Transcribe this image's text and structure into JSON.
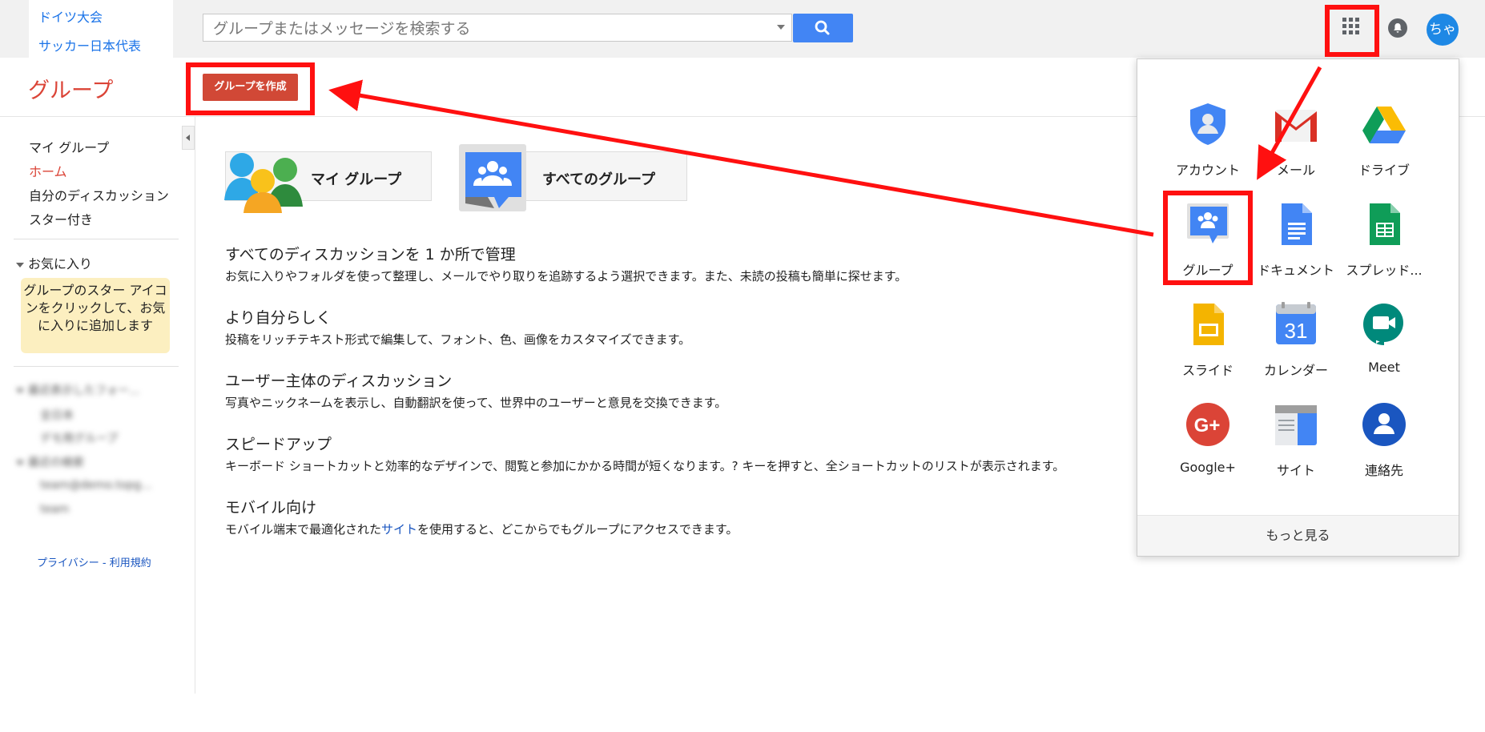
{
  "topbar": {
    "brand_links": [
      "ドイツ大会",
      "サッカー日本代表"
    ],
    "search_placeholder": "グループまたはメッセージを検索する",
    "avatar_text": "ちゃ"
  },
  "header": {
    "title": "グループ",
    "create_button": "グループを作成"
  },
  "sidebar": {
    "nav": [
      "マイ グループ",
      "ホーム",
      "自分のディスカッション",
      "スター付き"
    ],
    "active_index": 1,
    "favorites_header": "お気に入り",
    "favorites_tip": "グループのスター アイコンをクリックして、お気に入りに追加します",
    "recent_groups_header": "最近表示したフォー...",
    "recent_groups": [
      "全日本",
      "デモ用グループ"
    ],
    "recent_search_header": "最近の検索",
    "recent_searches": [
      "team@demo.topg...",
      "team"
    ],
    "footer": "プライバシー - 利用規約"
  },
  "main": {
    "cards": [
      "マイ グループ",
      "すべてのグループ"
    ],
    "sections": [
      {
        "title": "すべてのディスカッションを 1 か所で管理",
        "body": "お気に入りやフォルダを使って整理し、メールでやり取りを追跡するよう選択できます。また、未読の投稿も簡単に探せます。"
      },
      {
        "title": "より自分らしく",
        "body": "投稿をリッチテキスト形式で編集して、フォント、色、画像をカスタマイズできます。"
      },
      {
        "title": "ユーザー主体のディスカッション",
        "body": "写真やニックネームを表示し、自動翻訳を使って、世界中のユーザーと意見を交換できます。"
      },
      {
        "title": "スピードアップ",
        "body": "キーボード ショートカットと効率的なデザインで、閲覧と参加にかかる時間が短くなります。? キーを押すと、全ショートカットのリストが表示されます。"
      }
    ],
    "mobile": {
      "title": "モバイル向け",
      "body_before": "モバイル端末で最適化された",
      "link": "サイト",
      "body_after": "を使用すると、どこからでもグループにアクセスできます。"
    }
  },
  "apps_panel": {
    "apps": [
      {
        "label": "アカウント",
        "icon": "account-icon"
      },
      {
        "label": "メール",
        "icon": "gmail-icon"
      },
      {
        "label": "ドライブ",
        "icon": "drive-icon"
      },
      {
        "label": "グループ",
        "icon": "groups-icon"
      },
      {
        "label": "ドキュメント",
        "icon": "docs-icon"
      },
      {
        "label": "スプレッド...",
        "icon": "sheets-icon"
      },
      {
        "label": "スライド",
        "icon": "slides-icon"
      },
      {
        "label": "カレンダー",
        "icon": "calendar-icon"
      },
      {
        "label": "Meet",
        "icon": "meet-icon"
      },
      {
        "label": "Google+",
        "icon": "google-plus-icon"
      },
      {
        "label": "サイト",
        "icon": "sites-icon"
      },
      {
        "label": "連絡先",
        "icon": "contacts-icon"
      }
    ],
    "calendar_day": "31",
    "more": "もっと見る"
  },
  "colors": {
    "accent_red": "#db4437",
    "create_button": "#d14836",
    "search_blue": "#4285f4",
    "annotation_red": "#ff1010",
    "favorites_tip_bg": "#fcefc0"
  }
}
